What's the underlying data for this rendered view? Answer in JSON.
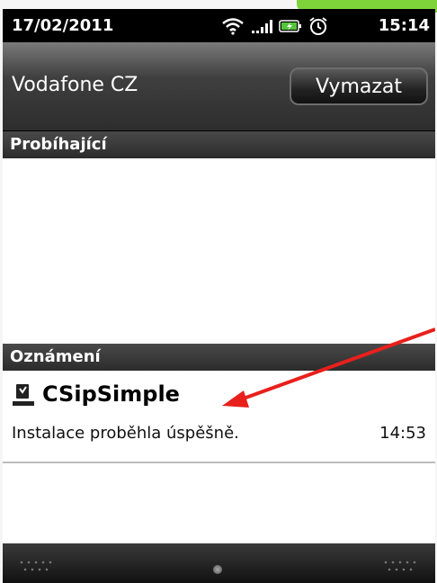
{
  "status_bar": {
    "date": "17/02/2011",
    "time": "15:14",
    "icons": [
      "wifi-icon",
      "signal-icon",
      "battery-icon",
      "alarm-icon"
    ]
  },
  "header": {
    "carrier": "Vodafone CZ",
    "clear_label": "Vymazat"
  },
  "sections": {
    "ongoing_label": "Probíhající",
    "notifications_label": "Oznámení"
  },
  "notification": {
    "app_name": "CSipSimple",
    "icon": "download-done-icon",
    "message": "Instalace proběhla úspěšně.",
    "time": "14:53"
  },
  "colors": {
    "accent_green": "#7fd33a",
    "arrow_red": "#e8201c"
  }
}
